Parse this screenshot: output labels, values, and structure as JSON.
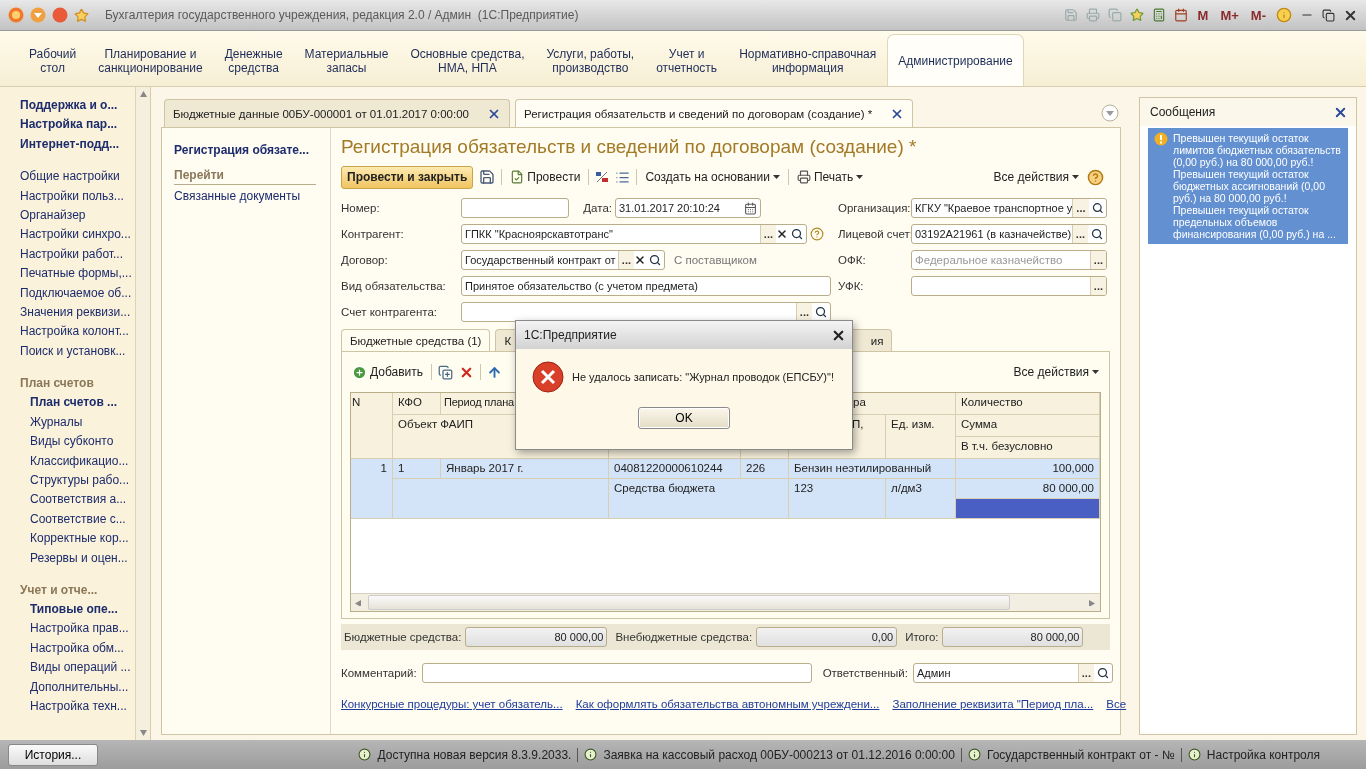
{
  "window": {
    "title": "Бухгалтерия государственного учреждения, редакция 2.0 / Админ  (1С:Предприятие)",
    "memory_buttons": [
      "M",
      "M+",
      "M-"
    ]
  },
  "sections": [
    {
      "label": "Рабочий\nстол",
      "selected": false
    },
    {
      "label": "Планирование и\nсанкционирование",
      "selected": false
    },
    {
      "label": "Денежные\nсредства",
      "selected": false
    },
    {
      "label": "Материальные\nзапасы",
      "selected": false
    },
    {
      "label": "Основные средства,\nНМА, НПА",
      "selected": false
    },
    {
      "label": "Услуги, работы,\nпроизводство",
      "selected": false
    },
    {
      "label": "Учет и\nотчетность",
      "selected": false
    },
    {
      "label": "Нормативно-справочная\nинформация",
      "selected": false
    },
    {
      "label": "Администрирование",
      "selected": true
    }
  ],
  "sidebar": {
    "groups": [
      {
        "items": [
          {
            "label": "Поддержка и о...",
            "bold": true
          },
          {
            "label": "Настройка пар...",
            "bold": true
          },
          {
            "label": "Интернет-подд...",
            "bold": true
          }
        ]
      },
      {
        "items": [
          {
            "label": "Общие настройки",
            "bold": false
          },
          {
            "label": "Настройки польз...",
            "bold": false
          },
          {
            "label": "Органайзер",
            "bold": false
          },
          {
            "label": "Настройки синхро...",
            "bold": false
          },
          {
            "label": "Настройки работ...",
            "bold": false
          },
          {
            "label": "Печатные формы,...",
            "bold": false
          },
          {
            "label": "Подключаемое об...",
            "bold": false
          },
          {
            "label": "Значения реквизи...",
            "bold": false
          },
          {
            "label": "Настройка колонт...",
            "bold": false
          },
          {
            "label": "Поиск и установк...",
            "bold": false
          }
        ]
      },
      {
        "title": "План счетов",
        "items": [
          {
            "label": "План счетов ...",
            "bold": true
          },
          {
            "label": "Журналы",
            "bold": false
          },
          {
            "label": "Виды субконто",
            "bold": false
          },
          {
            "label": "Классификацио...",
            "bold": false
          },
          {
            "label": "Структуры рабо...",
            "bold": false
          },
          {
            "label": "Соответствия а...",
            "bold": false
          },
          {
            "label": "Соответствие с...",
            "bold": false
          },
          {
            "label": "Корректные кор...",
            "bold": false
          },
          {
            "label": "Резервы и оцен...",
            "bold": false
          }
        ]
      },
      {
        "title": "Учет и отче...",
        "items": [
          {
            "label": "Типовые опе...",
            "bold": true
          },
          {
            "label": "Настройка прав...",
            "bold": false
          },
          {
            "label": "Настройка обм...",
            "bold": false
          },
          {
            "label": "Виды операций ...",
            "bold": false
          },
          {
            "label": "Дополнительны...",
            "bold": false
          },
          {
            "label": "Настройка техн...",
            "bold": false
          }
        ]
      }
    ]
  },
  "doc_tabs": [
    {
      "label": "Бюджетные данные 00БУ-000001 от 01.01.2017 0:00:00",
      "selected": false
    },
    {
      "label": "Регистрация обязательств и сведений по договорам (создание) *",
      "selected": true
    }
  ],
  "form_nav": {
    "title": "Регистрация обязате...",
    "section": "Перейти",
    "items": [
      "Связанные документы"
    ]
  },
  "form": {
    "title": "Регистрация обязательств и сведений по договорам (создание) *",
    "toolbar": {
      "primary": "Провести и закрыть",
      "post": "Провести",
      "create_based": "Создать на основании",
      "print": "Печать",
      "all_actions": "Все действия"
    },
    "number": {
      "label": "Номер:"
    },
    "date": {
      "label": "Дата:",
      "value": "31.01.2017 20:10:24",
      "kind": "date"
    },
    "counterparty": {
      "label": "Контрагент:",
      "value": "ГПКК \"Красноярскавтотранс\"",
      "choose": "...",
      "kind": "ref_clear_help"
    },
    "contract": {
      "label": "Договор:",
      "value": "Государственный контракт от",
      "choose": "...",
      "kind": "ref_clear",
      "note": "С поставщиком"
    },
    "obligation_type": {
      "label": "Вид обязательства:",
      "value": "Принятое обязательство (с учетом предмета)"
    },
    "counterparty_account": {
      "label": "Счет контрагента:",
      "choose": "...",
      "kind": "ref"
    },
    "organization": {
      "label": "Организация:",
      "value": "КГКУ \"Краевое транспортное у",
      "choose": "...",
      "kind": "ref"
    },
    "account": {
      "label": "Лицевой счет:",
      "value": "03192А21961 (в казначействе)",
      "choose": "...",
      "kind": "ref"
    },
    "ofk": {
      "label": "ОФК:",
      "placeholder": "Федеральное казначейство",
      "choose": "...",
      "kind": "choice"
    },
    "ufk": {
      "label": "УФК:",
      "choose": "...",
      "kind": "choice"
    }
  },
  "table_tabs": [
    {
      "label": "Бюджетные средства (1)",
      "selected": true
    },
    {
      "label": "К",
      "selected": false
    },
    {
      "label": "ия",
      "selected": false
    }
  ],
  "table": {
    "add": "Добавить",
    "all_actions": "Все действия",
    "headers": {
      "n": "N",
      "kfo": "КФО",
      "period": "Период плана",
      "column_6": "ра",
      "quantity": "Количество",
      "object": "Объект ФАИП",
      "column_7": "П,",
      "unit": "Ед. изм.",
      "sum": "Сумма",
      "unconditional": "В т.ч. безусловно"
    },
    "rows": [
      {
        "selected": true,
        "n": "1",
        "kfo": "1",
        "period": "Январь 2017 г.",
        "column_4": "04081220000610244",
        "column_5": "226",
        "nomenclature": "Бензин неэтилированный",
        "quantity": "100,000",
        "source": "Средства бюджета",
        "code": "123",
        "unit": "л/дм3",
        "sum": "80 000,00"
      }
    ]
  },
  "totals": [
    {
      "label": "Бюджетные средства:",
      "value": "80 000,00"
    },
    {
      "label": "Внебюджетные средства:",
      "value": "0,00"
    },
    {
      "label": "Итого:",
      "value": "80 000,00"
    }
  ],
  "comment": {
    "label": "Комментарий:"
  },
  "responsible": {
    "label": "Ответственный:",
    "value": "Админ",
    "choose": "..."
  },
  "links": [
    "Конкурсные процедуры: учет обязатель...",
    "Как оформлять обязательства автономным учреждени...",
    "Заполнение реквизита \"Период пла...",
    "Все"
  ],
  "dialog": {
    "title": "1С:Предприятие",
    "message": "Не удалось записать: \"Журнал проводок (ЕПСБУ)\"!",
    "button": "OK"
  },
  "messages": {
    "title": "Сообщения",
    "items": [
      {
        "selected": true,
        "text": "Превышен текущий остаток лимитов бюджетных обязательств (0,00 руб.) на 80 000,00 руб.!\nПревышен текущий остаток бюджетных ассигнований (0,00 руб.) на 80 000,00 руб.!\nПревышен текущий остаток предельных объемов финансирования (0,00 руб.) на ..."
      }
    ]
  },
  "status_bar": {
    "history": "История...",
    "items": [
      "Доступна новая версия 8.3.9.2033.",
      "Заявка на кассовый расход 00БУ-000213 от 01.12.2016 0:00:00",
      "Государственный контракт от - №",
      "Настройка контроля"
    ]
  }
}
